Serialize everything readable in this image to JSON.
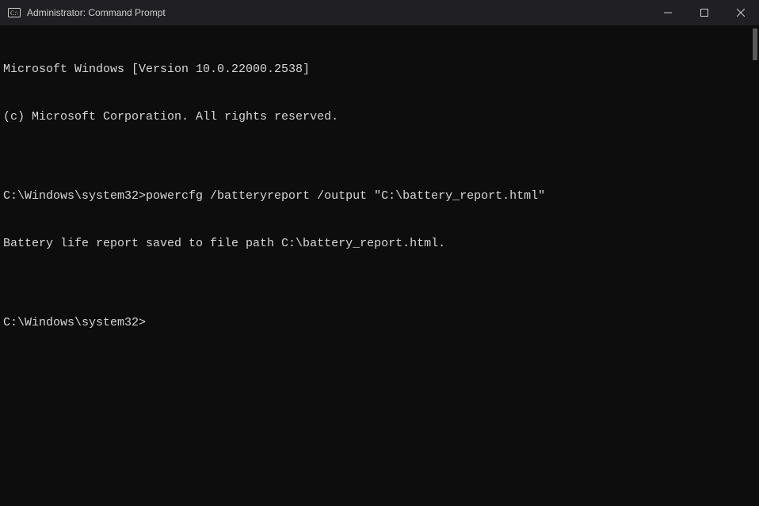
{
  "titlebar": {
    "title": "Administrator: Command Prompt"
  },
  "terminal": {
    "line1": "Microsoft Windows [Version 10.0.22000.2538]",
    "line2": "(c) Microsoft Corporation. All rights reserved.",
    "blank1": "",
    "line3_prompt": "C:\\Windows\\system32>",
    "line3_cmd": "powercfg /batteryreport /output \"C:\\battery_report.html\"",
    "line4": "Battery life report saved to file path C:\\battery_report.html.",
    "blank2": "",
    "line5_prompt": "C:\\Windows\\system32>"
  }
}
